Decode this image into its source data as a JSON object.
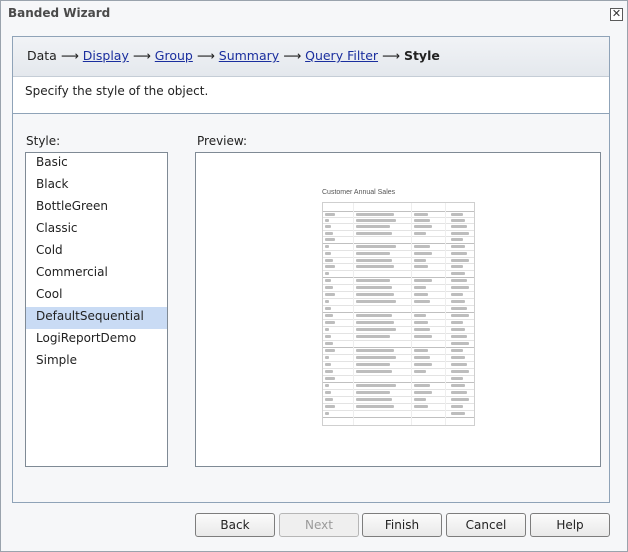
{
  "window": {
    "title": "Banded Wizard",
    "close_glyph": "✕"
  },
  "breadcrumb": {
    "steps": [
      "Data",
      "Display",
      "Group",
      "Summary",
      "Query Filter",
      "Style"
    ],
    "arrow": "⟶"
  },
  "instruction": "Specify the style of the object.",
  "style_panel": {
    "label": "Style:",
    "items": [
      "Basic",
      "Black",
      "BottleGreen",
      "Classic",
      "Cold",
      "Commercial",
      "Cool",
      "DefaultSequential",
      "LogiReportDemo",
      "Simple"
    ],
    "selected": "DefaultSequential"
  },
  "preview_panel": {
    "label": "Preview:",
    "thumbnail_title": "Customer Annual Sales"
  },
  "buttons": {
    "back": "Back",
    "next": "Next",
    "finish": "Finish",
    "cancel": "Cancel",
    "help": "Help"
  },
  "colors": {
    "link": "#1a2e9e",
    "selection": "#c9dbf4",
    "frame_border": "#8fa3b8"
  }
}
